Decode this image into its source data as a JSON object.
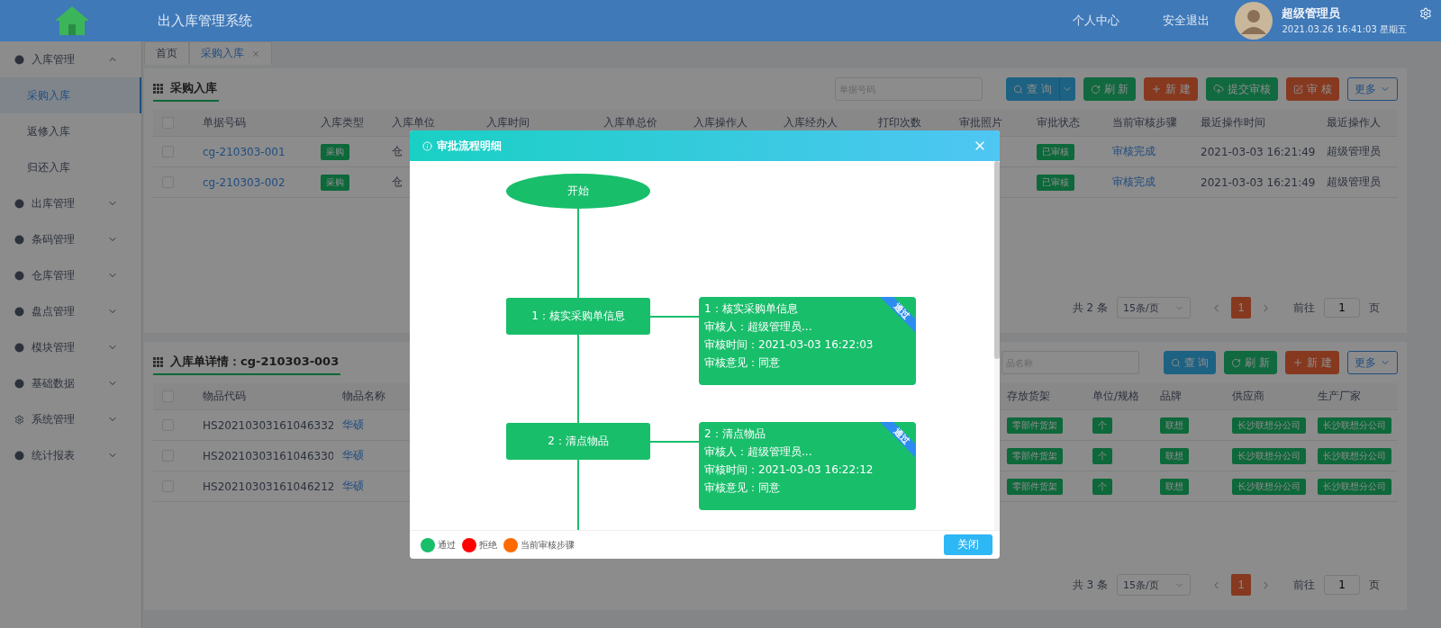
{
  "header": {
    "title": "出入库管理系统",
    "links": [
      "个人中心",
      "安全退出"
    ],
    "user": {
      "name": "超级管理员",
      "datetime": "2021.03.26 16:41:03 星期五"
    }
  },
  "sidebar": {
    "items": [
      {
        "label": "入库管理",
        "expanded": true,
        "children": [
          {
            "label": "采购入库",
            "selected": true
          },
          {
            "label": "返修入库",
            "selected": false
          },
          {
            "label": "归还入库",
            "selected": false
          }
        ]
      },
      {
        "label": "出库管理",
        "expanded": false
      },
      {
        "label": "条码管理",
        "expanded": false
      },
      {
        "label": "仓库管理",
        "expanded": false
      },
      {
        "label": "盘点管理",
        "expanded": false
      },
      {
        "label": "模块管理",
        "expanded": false
      },
      {
        "label": "基础数据",
        "expanded": false
      },
      {
        "label": "系统管理",
        "expanded": false
      },
      {
        "label": "统计报表",
        "expanded": false
      }
    ]
  },
  "tabs": [
    {
      "label": "首页",
      "selected": false,
      "closable": false
    },
    {
      "label": "采购入库",
      "selected": true,
      "closable": true
    }
  ],
  "purchase_panel": {
    "title": "采购入库",
    "search_placeholder": "单据号码",
    "buttons": [
      {
        "label": "查 询",
        "kind": "query"
      },
      {
        "label": "刷 新",
        "kind": "refresh"
      },
      {
        "label": "新 建",
        "kind": "create"
      },
      {
        "label": "提交审核",
        "kind": "submit"
      },
      {
        "label": "审 核",
        "kind": "audit"
      },
      {
        "label": "更多",
        "kind": "more"
      }
    ],
    "table": {
      "select_all_checked": false,
      "columns": [
        "单据号码",
        "入库类型",
        "入库单位",
        "入库时间",
        "入库单总价",
        "入库操作人",
        "入库经办人",
        "打印次数",
        "审批照片",
        "审批状态",
        "当前审核步骤",
        "最近操作时间",
        "最近操作人"
      ],
      "rows": [
        {
          "checked": false,
          "cells": [
            "cg-210303-001",
            "采购",
            "仓",
            "已审核",
            "审核完成",
            "2021-03-03 16:21:49",
            "超级管理员"
          ]
        },
        {
          "checked": false,
          "cells": [
            "cg-210303-002",
            "采购",
            "仓",
            "已审核",
            "审核完成",
            "2021-03-03 16:21:49",
            "超级管理员"
          ]
        }
      ]
    },
    "pagination": {
      "total": "共 2 条",
      "page_size": "15条/页",
      "pages": [
        {
          "label": "1",
          "selected": true
        }
      ],
      "goto_label": "前往",
      "goto_value": "1",
      "page_suffix": "页"
    }
  },
  "detail_panel": {
    "title": "入库单详情：cg-210303-003",
    "search_placeholder": "品名称",
    "buttons": [
      {
        "label": "查 询",
        "kind": "query_plain"
      },
      {
        "label": "刷 新",
        "kind": "refresh"
      },
      {
        "label": "新 建",
        "kind": "create"
      },
      {
        "label": "更多",
        "kind": "more"
      }
    ],
    "table": {
      "select_all_checked": false,
      "columns": [
        "物品代码",
        "物品名称",
        "存放货架",
        "单位/规格",
        "品牌",
        "供应商",
        "生产厂家"
      ],
      "rows": [
        {
          "checked": false,
          "cells": [
            "HS20210303161046332",
            "华硕",
            "零部件货架",
            "个",
            "联想",
            "长沙联想分公司",
            "长沙联想分公司"
          ]
        },
        {
          "checked": false,
          "cells": [
            "HS20210303161046330",
            "华硕",
            "零部件货架",
            "个",
            "联想",
            "长沙联想分公司",
            "长沙联想分公司"
          ]
        },
        {
          "checked": false,
          "cells": [
            "HS20210303161046212",
            "华硕",
            "零部件货架",
            "个",
            "联想",
            "长沙联想分公司",
            "长沙联想分公司"
          ]
        }
      ]
    },
    "pagination": {
      "total": "共 3 条",
      "page_size": "15条/页",
      "pages": [
        {
          "label": "1",
          "selected": true
        }
      ],
      "goto_label": "前往",
      "goto_value": "1",
      "page_suffix": "页"
    }
  },
  "dialog": {
    "title": "审批流程明细",
    "start_label": "开始",
    "steps": [
      {
        "node_label": "1：核实采购单信息",
        "title": "1：核实采购单信息",
        "reviewer": "审核人：超级管理员...",
        "time": "审核时间：2021-03-03 16:22:03",
        "opinion": "审核意见：同意",
        "result": "通过",
        "kind": "pass"
      },
      {
        "node_label": "2：清点物品",
        "title": "2：清点物品",
        "reviewer": "审核人：超级管理员...",
        "time": "审核时间：2021-03-03 16:22:12",
        "opinion": "审核意见：同意",
        "result": "通过",
        "kind": "pass"
      }
    ],
    "legend": [
      {
        "label": "通过",
        "color": "#19be6b"
      },
      {
        "label": "拒绝",
        "color": "#ff0000"
      },
      {
        "label": "当前审核步骤",
        "color": "#ff6a00"
      }
    ],
    "close_label": "关闭"
  }
}
